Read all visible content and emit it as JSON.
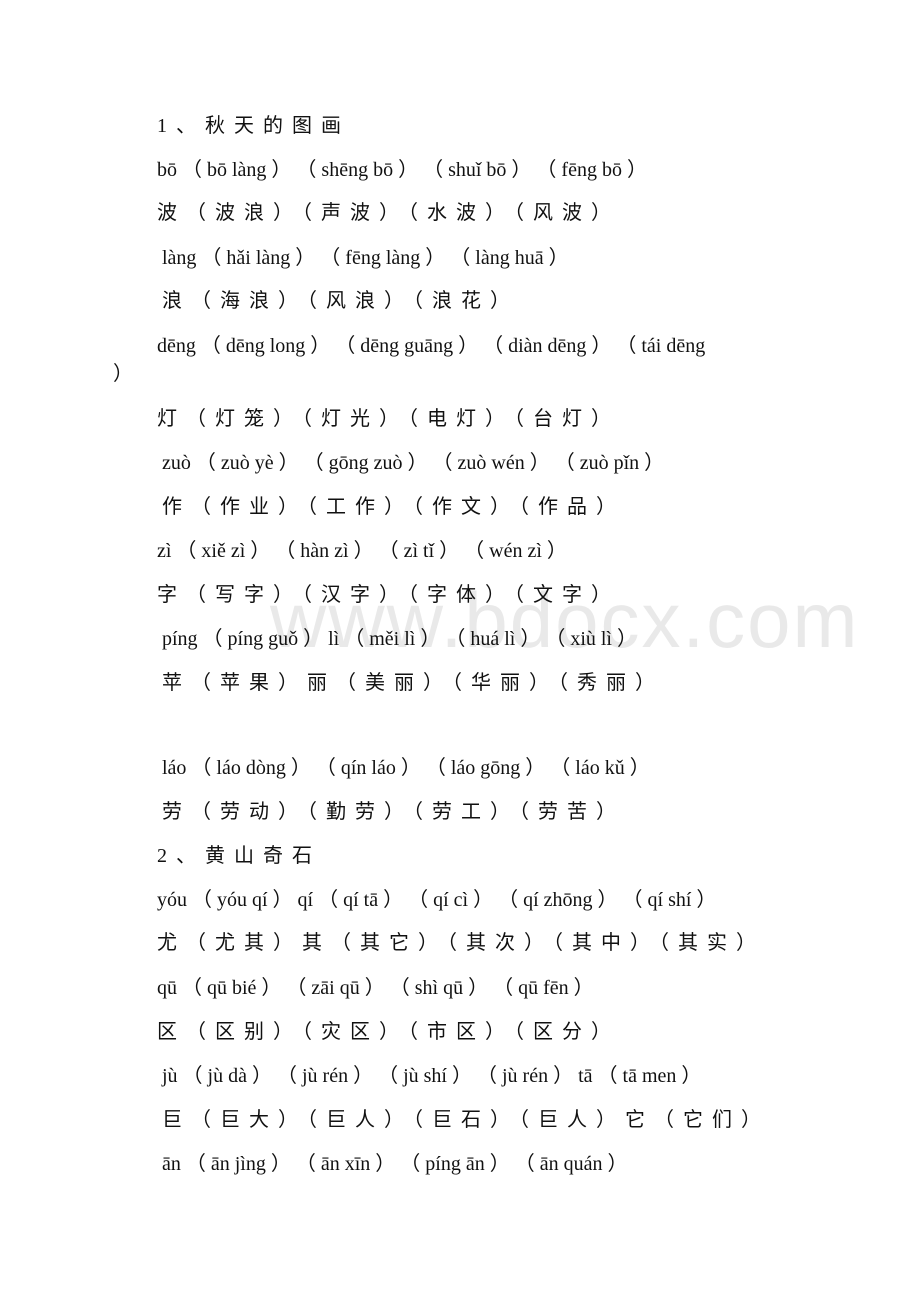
{
  "watermark": "www.bdocx.com",
  "lines": [
    "1、秋天的图画",
    "bō （ bō làng ） （ shēng bō ） （ shuǐ bō ） （ fēng bō ）",
    "波（波浪）（声波）（水波）（风波）",
    "làng （ hǎi làng ） （ fēng làng ） （ làng huā ）",
    "浪（海浪）（风浪）（浪花）",
    "dēng （ dēng long ） （ dēng guāng ） （ diàn dēng ） （ tái dēng",
    "）",
    "灯（灯笼）（灯光）（电灯）（台灯）",
    "zuò （ zuò yè ） （ gōng zuò ） （ zuò wén ） （ zuò pǐn ）",
    "作（作业）（工作）（作文）（作品）",
    "zì （ xiě zì ） （ hàn zì ） （ zì tǐ ） （ wén zì ）",
    "字（写字）（汉字）（字体）（文字）",
    "píng （ píng guǒ ） lì （ měi lì ） （ huá lì ） （ xiù lì ）",
    "苹（苹果）丽（美丽）（华丽）（秀丽）",
    "láo （ láo dòng ） （ qín láo ） （ láo gōng ） （ láo kǔ ）",
    "劳（劳动）（勤劳）（劳工）（劳苦）",
    "2、黄山奇石",
    "yóu （ yóu qí ） qí （ qí tā ） （ qí cì ） （ qí zhōng ） （ qí shí ）",
    "尤（尤其）其（其它）（其次）（其中）（其实）",
    "qū （ qū bié ） （ zāi qū ） （ shì qū ） （ qū fēn ）",
    "区（区别）（灾区）（市区）（区分）",
    "jù （ jù dà ） （ jù rén ） （ jù shí ） （ jù rén ） tā （ tā men ）",
    "巨（巨大）（巨人）（巨石）（巨人）它（它们）",
    "ān （ ān jìng ） （ ān xīn ） （ píng ān ） （ ān quán ）"
  ]
}
